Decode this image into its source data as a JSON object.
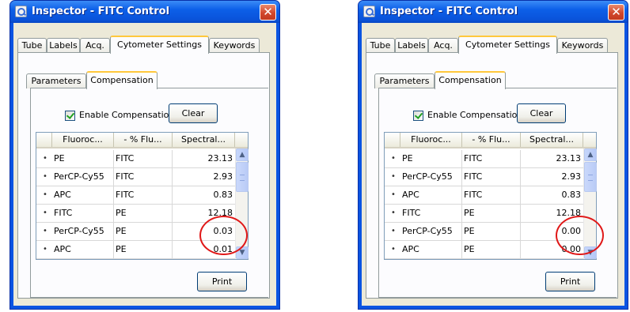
{
  "windows": [
    {
      "title": "Inspector - FITC Control",
      "outer_tabs": [
        "Tube",
        "Labels",
        "Acq.",
        "Cytometer Settings",
        "Keywords"
      ],
      "inner_tabs": [
        "Parameters",
        "Compensation"
      ],
      "enable_compensation_label": "Enable Compensation",
      "clear_label": "Clear",
      "print_label": "Print",
      "columns": [
        "Fluoroc...",
        "- % Flu...",
        "Spectral..."
      ],
      "rows": [
        {
          "fluor": "PE",
          "pct": "FITC",
          "value": "23.13"
        },
        {
          "fluor": "PerCP-Cy55",
          "pct": "FITC",
          "value": "2.93"
        },
        {
          "fluor": "APC",
          "pct": "FITC",
          "value": "0.83"
        },
        {
          "fluor": "FITC",
          "pct": "PE",
          "value": "12.18"
        },
        {
          "fluor": "PerCP-Cy55",
          "pct": "PE",
          "value": "0.03"
        },
        {
          "fluor": "APC",
          "pct": "PE",
          "value": "0.01"
        }
      ]
    },
    {
      "title": "Inspector - FITC Control",
      "outer_tabs": [
        "Tube",
        "Labels",
        "Acq.",
        "Cytometer Settings",
        "Keywords"
      ],
      "inner_tabs": [
        "Parameters",
        "Compensation"
      ],
      "enable_compensation_label": "Enable Compensation",
      "clear_label": "Clear",
      "print_label": "Print",
      "columns": [
        "Fluoroc...",
        "- % Flu...",
        "Spectral..."
      ],
      "rows": [
        {
          "fluor": "PE",
          "pct": "FITC",
          "value": "23.13"
        },
        {
          "fluor": "PerCP-Cy55",
          "pct": "FITC",
          "value": "2.93"
        },
        {
          "fluor": "APC",
          "pct": "FITC",
          "value": "0.83"
        },
        {
          "fluor": "FITC",
          "pct": "PE",
          "value": "12.18"
        },
        {
          "fluor": "PerCP-Cy55",
          "pct": "PE",
          "value": "0.00"
        },
        {
          "fluor": "APC",
          "pct": "PE",
          "value": "0.00"
        }
      ]
    }
  ],
  "icons": {
    "title": "inspector-icon",
    "close": "close-icon",
    "row_bullet": "row-bullet-icon",
    "scroll_up": "scroll-up-arrow-icon",
    "scroll_down": "scroll-down-arrow-icon",
    "checkmark": "checkmark-icon"
  },
  "colors": {
    "titlebar": "#0a54e2",
    "close_button": "#d2472c",
    "active_tab_accent": "#ffc83c",
    "highlight_circle": "#e01818"
  }
}
